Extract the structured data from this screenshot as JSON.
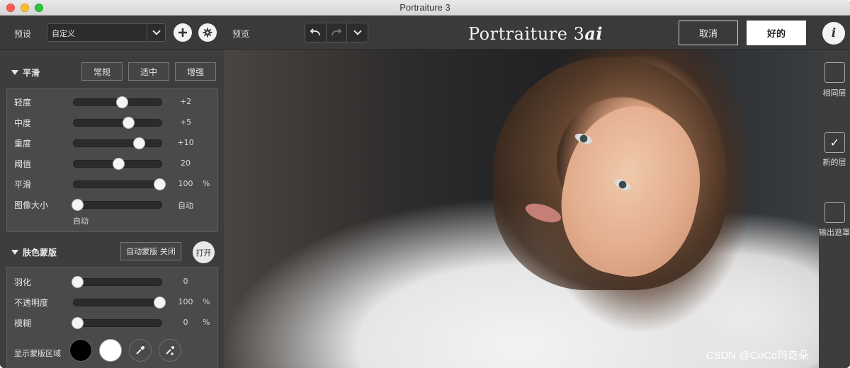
{
  "window": {
    "title": "Portraiture 3"
  },
  "topbar": {
    "preset_label": "预设",
    "preset_value": "自定义",
    "preview_label": "预览",
    "brand_main": "Portraiture 3",
    "brand_ai": "ai",
    "cancel": "取消",
    "ok": "好的",
    "info": "i"
  },
  "smoothing": {
    "title": "平滑",
    "presets": [
      "常规",
      "适中",
      "增强"
    ],
    "sliders": [
      {
        "label": "轻度",
        "value": "+2",
        "unit": "",
        "fraction": 0.54
      },
      {
        "label": "中度",
        "value": "+5",
        "unit": "",
        "fraction": 0.61
      },
      {
        "label": "重度",
        "value": "+10",
        "unit": "",
        "fraction": 0.73
      },
      {
        "label": "阈值",
        "value": "20",
        "unit": "",
        "fraction": 0.5
      },
      {
        "label": "平滑",
        "value": "100",
        "unit": "%",
        "fraction": 0.96
      },
      {
        "label": "图像大小",
        "value": "自动",
        "unit": "",
        "fraction": 0.04
      }
    ],
    "image_size_note": "自动"
  },
  "skin_mask": {
    "title": "肤色蒙版",
    "auto_mask": "自动蒙版 关闭",
    "open": "打开",
    "sliders": [
      {
        "label": "羽化",
        "value": "0",
        "unit": "",
        "fraction": 0.04
      },
      {
        "label": "不透明度",
        "value": "100",
        "unit": "%",
        "fraction": 0.96
      },
      {
        "label": "模糊",
        "value": "0",
        "unit": "%",
        "fraction": 0.04
      }
    ],
    "show_area": "显示蒙版区域"
  },
  "right_panel": {
    "same_layer": "相同层",
    "new_layer": "新的层",
    "output_mask": "输出遮罩"
  },
  "preview": {
    "watermark": "CSDN @CoCo玛奇朵"
  },
  "colors": {
    "panel": "#3d3d3d",
    "accent_white": "#ffffff"
  }
}
